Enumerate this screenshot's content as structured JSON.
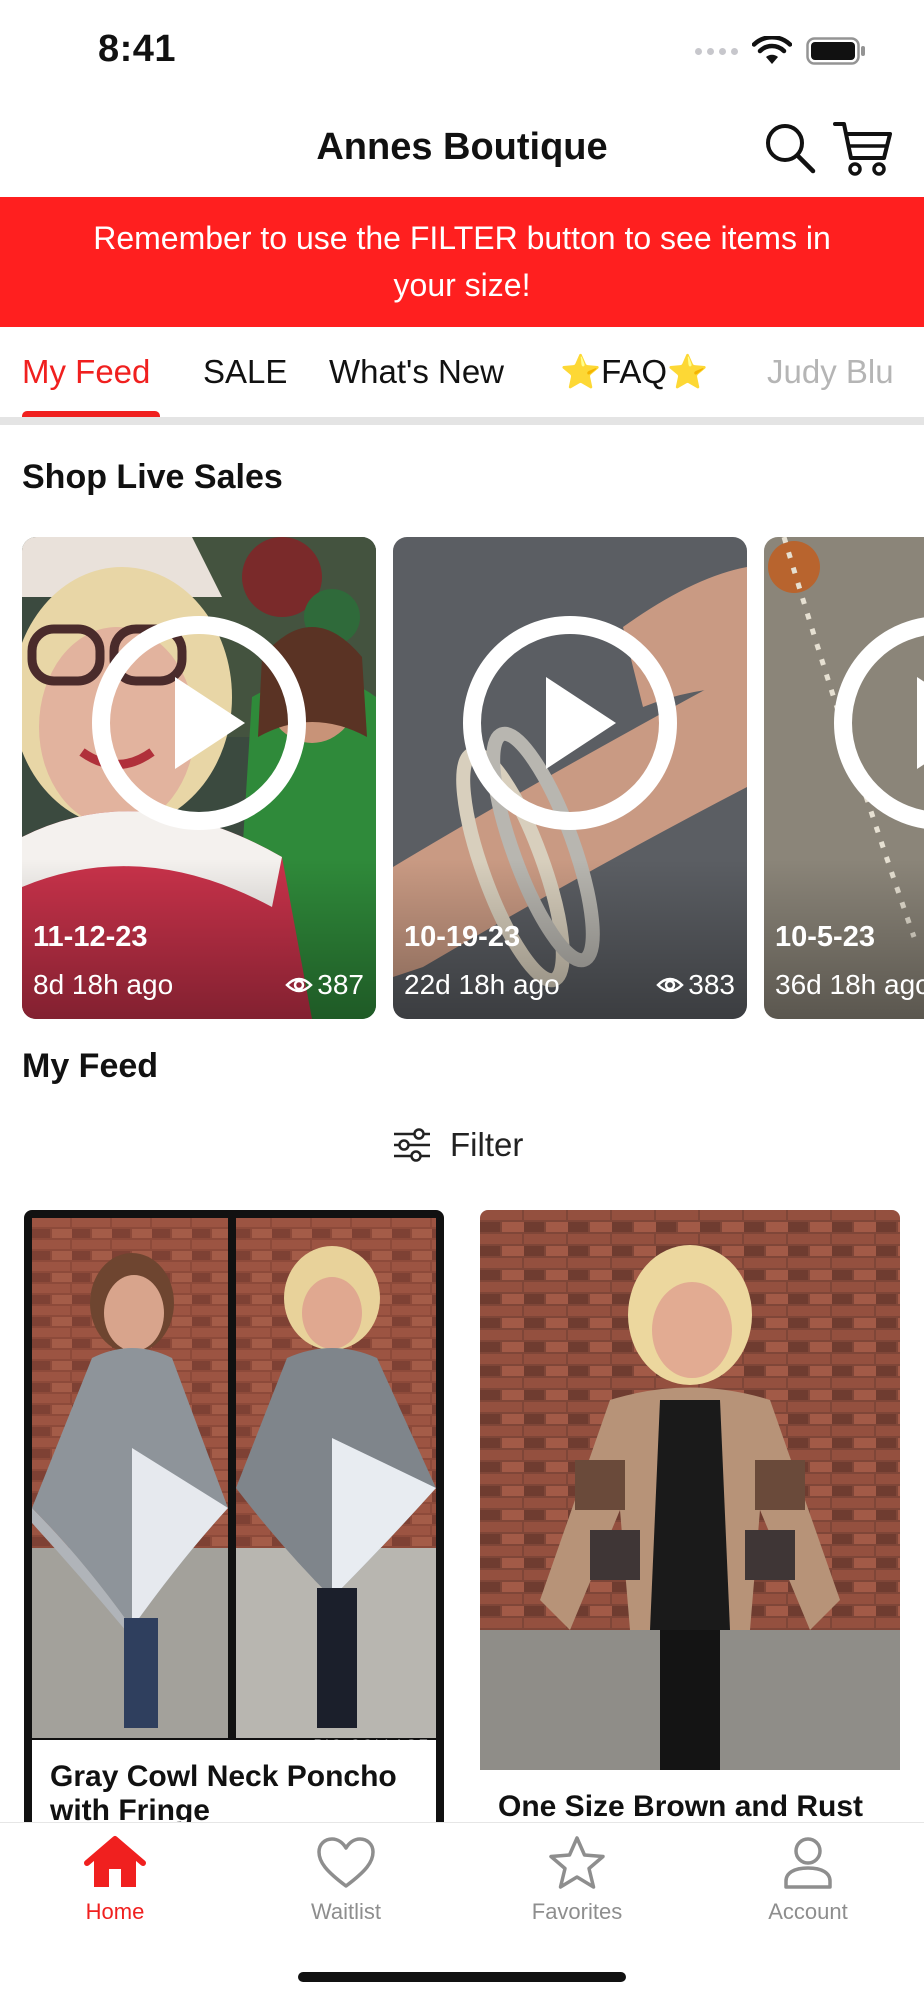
{
  "status_bar": {
    "time": "8:41"
  },
  "header": {
    "title": "Annes Boutique"
  },
  "banner": {
    "text": "Remember to use the FILTER button to see items in your size!"
  },
  "tabs": [
    {
      "label": "My Feed",
      "active": true
    },
    {
      "label": "SALE"
    },
    {
      "label": "What's New"
    },
    {
      "label": "⭐FAQ⭐"
    },
    {
      "label": "Judy Blu"
    }
  ],
  "live_sales": {
    "title": "Shop Live Sales",
    "items": [
      {
        "date": "11-12-23",
        "ago": "8d 18h ago",
        "views": "387"
      },
      {
        "date": "10-19-23",
        "ago": "22d 18h ago",
        "views": "383"
      },
      {
        "date": "10-5-23",
        "ago": "36d 18h ago",
        "views": ""
      }
    ]
  },
  "feed": {
    "title": "My Feed",
    "filter_label": "Filter",
    "products": [
      {
        "name": "Gray Cowl Neck Poncho with Fringe",
        "watermark": "PIC•COLLAGE"
      },
      {
        "name": "One Size Brown and Rust"
      }
    ]
  },
  "bottom_nav": [
    {
      "label": "Home",
      "icon": "home-icon",
      "active": true
    },
    {
      "label": "Waitlist",
      "icon": "heart-icon"
    },
    {
      "label": "Favorites",
      "icon": "star-icon"
    },
    {
      "label": "Account",
      "icon": "person-icon"
    }
  ],
  "colors": {
    "accent": "#f0201f",
    "banner": "#ff1f1f",
    "inactive": "#8e8e8e"
  }
}
